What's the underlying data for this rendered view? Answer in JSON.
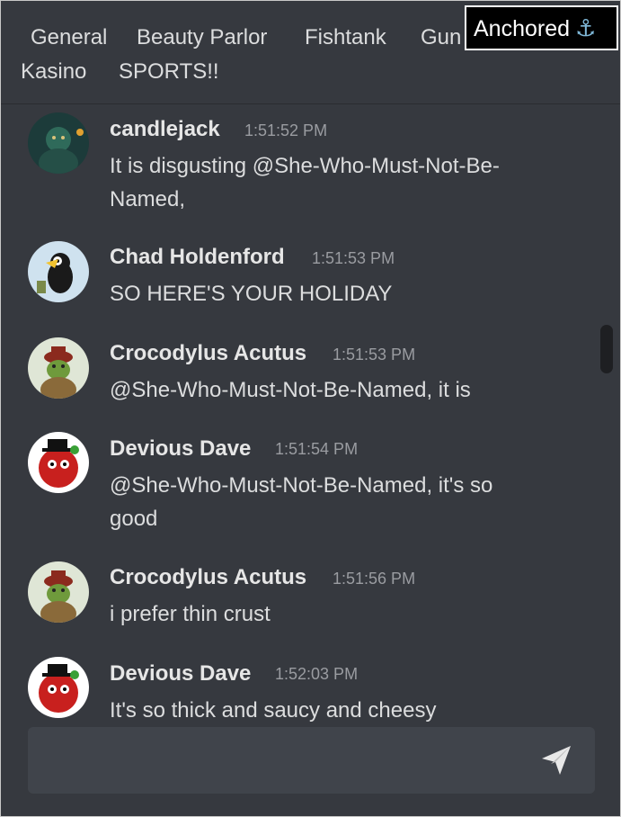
{
  "channels": [
    "General",
    "Beauty Parlor",
    "Fishtank",
    "Gun",
    "Kasino",
    "SPORTS!!"
  ],
  "anchored": {
    "label": "Anchored",
    "icon": "anchor-icon"
  },
  "messages": [
    {
      "user": "candlejack",
      "time": "1:51:52 PM",
      "text": "It is disgusting @She-Who-Must-Not-Be-Named,",
      "avatar": "candlejack-avatar"
    },
    {
      "user": "Chad Holdenford",
      "time": "1:51:53 PM",
      "text": "SO HERE'S YOUR HOLIDAY",
      "avatar": "chad-avatar"
    },
    {
      "user": "Crocodylus Acutus",
      "time": "1:51:53 PM",
      "text": "@She-Who-Must-Not-Be-Named, it is",
      "avatar": "crocodile-avatar"
    },
    {
      "user": "Devious Dave",
      "time": "1:51:54 PM",
      "text": "@She-Who-Must-Not-Be-Named, it's so good",
      "avatar": "dave-avatar"
    },
    {
      "user": "Crocodylus Acutus",
      "time": "1:51:56 PM",
      "text": "i prefer thin crust",
      "avatar": "crocodile-avatar"
    },
    {
      "user": "Devious Dave",
      "time": "1:52:03 PM",
      "text": "It's so thick and saucy and cheesy",
      "avatar": "dave-avatar"
    }
  ],
  "composer": {
    "placeholder": "",
    "send_icon": "send-icon"
  },
  "colors": {
    "background": "#36393f",
    "composer": "#40444b",
    "anchor_badge": "#000000"
  }
}
